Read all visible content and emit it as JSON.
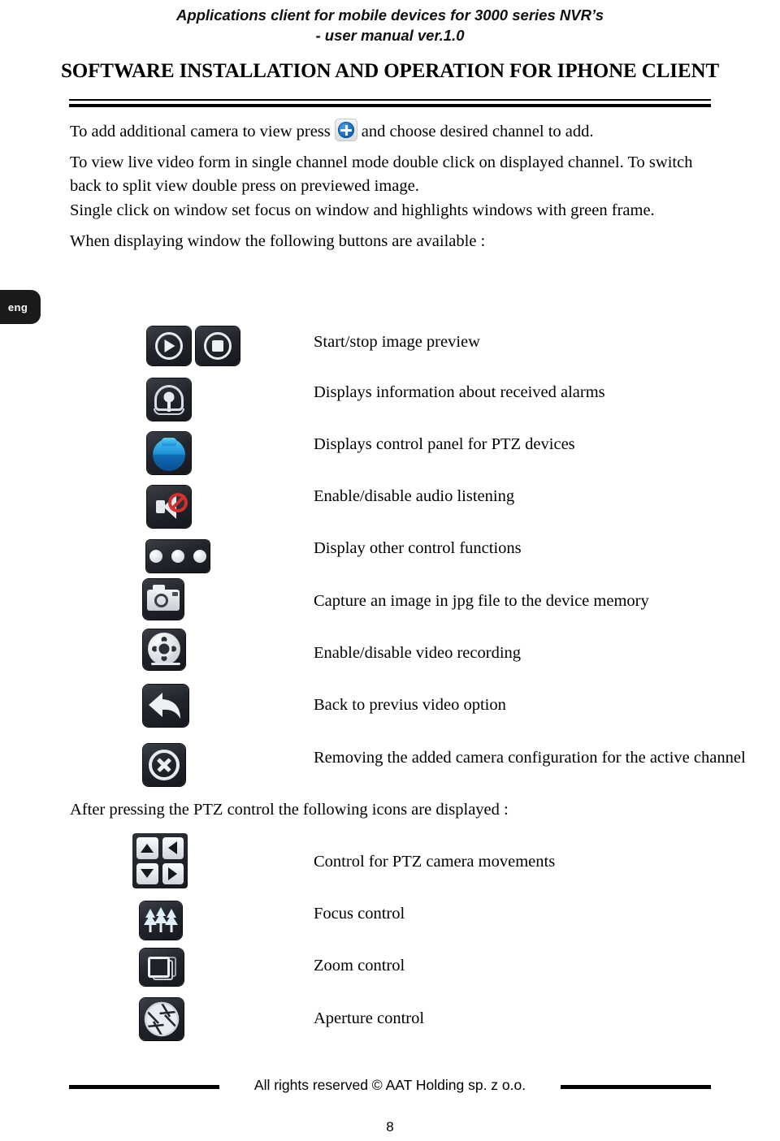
{
  "header": {
    "line1": "Applications client for mobile devices for 3000 series NVR’s",
    "line2": "- user manual ver.1.0"
  },
  "title": "SOFTWARE INSTALLATION AND OPERATION FOR IPHONE CLIENT",
  "lang_tab": "eng",
  "paragraphs": {
    "p1_before": "To add additional camera to view press",
    "p1_after": "and choose desired channel to add.",
    "p2": "To view live video form in single channel mode double click on displayed channel. To switch back to split view double press on previewed image.",
    "p3": "Single click on window set focus on window and highlights windows with green frame.",
    "p4": "When displaying window the following buttons are available :",
    "p5": "After pressing the PTZ control the following icons are displayed :"
  },
  "button_rows": [
    {
      "icon": "play-stop-icon",
      "label": "Start/stop image preview"
    },
    {
      "icon": "alarm-bell-icon",
      "label": "Displays information about received alarms"
    },
    {
      "icon": "ptz-dome-camera-icon",
      "label": "Displays control panel for PTZ devices"
    },
    {
      "icon": "audio-mute-icon",
      "label": "Enable/disable audio listening"
    },
    {
      "icon": "three-dots-icon",
      "label": "Display other control functions"
    },
    {
      "icon": "photo-camera-icon",
      "label": "Capture an image in jpg file to the device memory"
    },
    {
      "icon": "video-reel-icon",
      "label": "Enable/disable video recording"
    },
    {
      "icon": "back-arrow-icon",
      "label": "Back to previus video option"
    },
    {
      "icon": "circle-x-icon",
      "label": "Removing the added camera configuration for the active channel"
    }
  ],
  "ptz_rows": [
    {
      "icon": "dpad-arrows-icon",
      "label": "Control for PTZ camera movements"
    },
    {
      "icon": "focus-trees-icon",
      "label": "Focus control"
    },
    {
      "icon": "zoom-squares-icon",
      "label": "Zoom control"
    },
    {
      "icon": "aperture-icon",
      "label": "Aperture control"
    }
  ],
  "footer": {
    "copyright": "All rights reserved © AAT Holding sp. z o.o.",
    "page_number": "8"
  },
  "colors": {
    "accent_blue": "#1a8fd6",
    "plus_blue": "#0b5fb5",
    "mute_red": "#d32f2f",
    "button_dark": "#22262c"
  }
}
